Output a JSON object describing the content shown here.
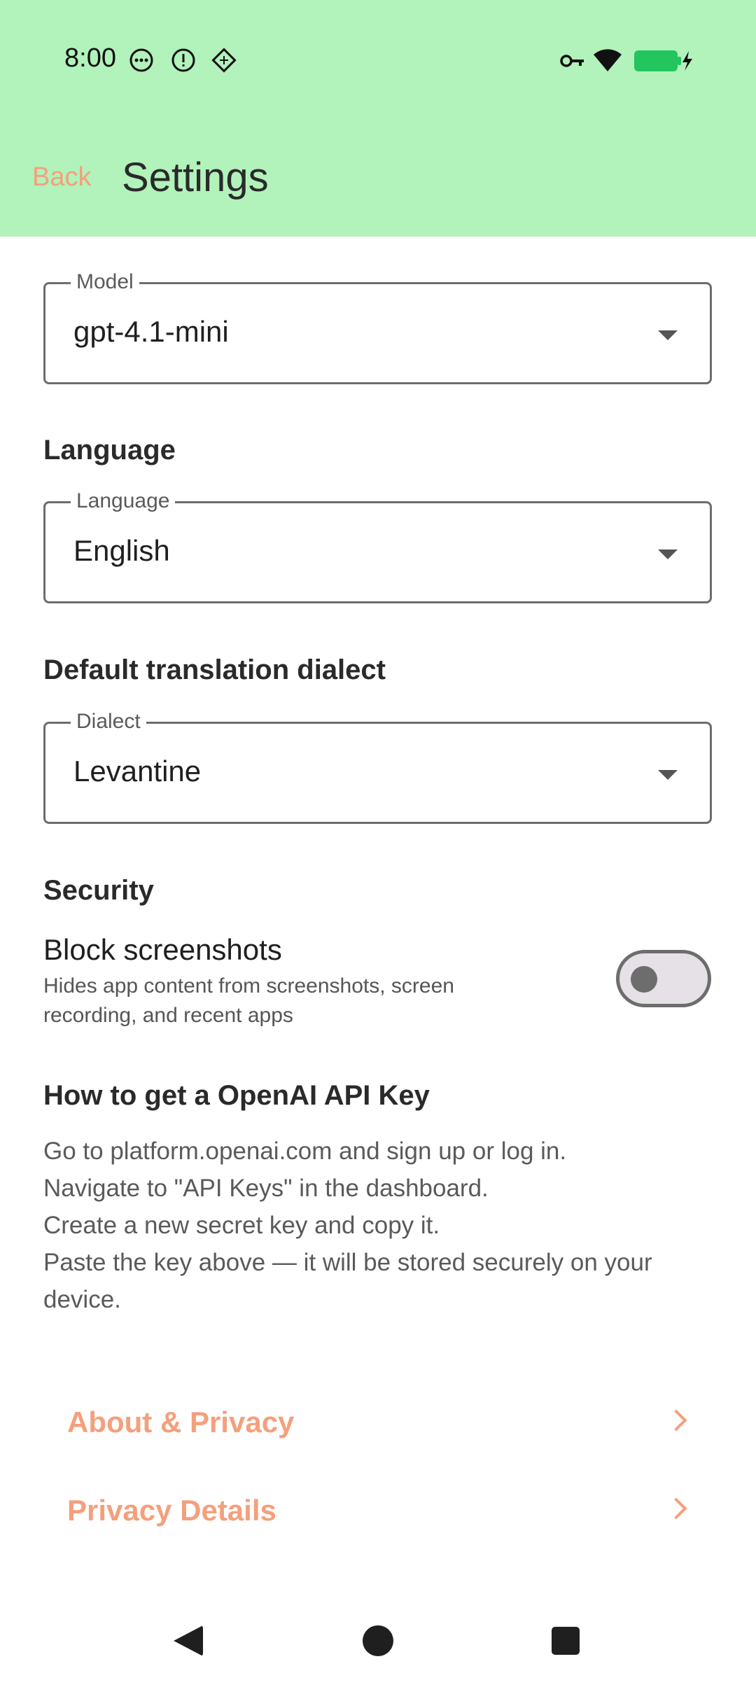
{
  "status_bar": {
    "time": "8:00",
    "left_icons": [
      "more-horiz-circle-icon",
      "alert-circle-icon",
      "diamond-grid-icon"
    ],
    "right_icons": [
      "vpn-key-icon",
      "wifi-icon",
      "battery-charging-icon"
    ],
    "battery_color": "#22c55e"
  },
  "header": {
    "back_label": "Back",
    "title": "Settings",
    "background_color": "#b2f2bb",
    "accent_color": "#f4a07c"
  },
  "model": {
    "label": "Model",
    "value": "gpt-4.1-mini"
  },
  "language": {
    "section_title": "Language",
    "label": "Language",
    "value": "English"
  },
  "dialect": {
    "section_title": "Default translation dialect",
    "label": "Dialect",
    "value": "Levantine"
  },
  "security": {
    "section_title": "Security",
    "block_screenshots_title": "Block screenshots",
    "block_screenshots_desc": "Hides app content from screenshots, screen recording, and recent apps",
    "block_screenshots_enabled": false
  },
  "help": {
    "title": "How to get a OpenAI API Key",
    "lines": [
      "Go to platform.openai.com and sign up or log in.",
      "Navigate to \"API Keys\" in the dashboard.",
      "Create a new secret key and copy it.",
      "Paste the key above — it will be stored securely on your device."
    ]
  },
  "links": [
    {
      "label": "About & Privacy",
      "icon": "chevron-right-icon"
    },
    {
      "label": "Privacy Details",
      "icon": "chevron-right-icon"
    }
  ],
  "nav_bar": {
    "icons": [
      "nav-back-icon",
      "nav-home-icon",
      "nav-recents-icon"
    ]
  }
}
